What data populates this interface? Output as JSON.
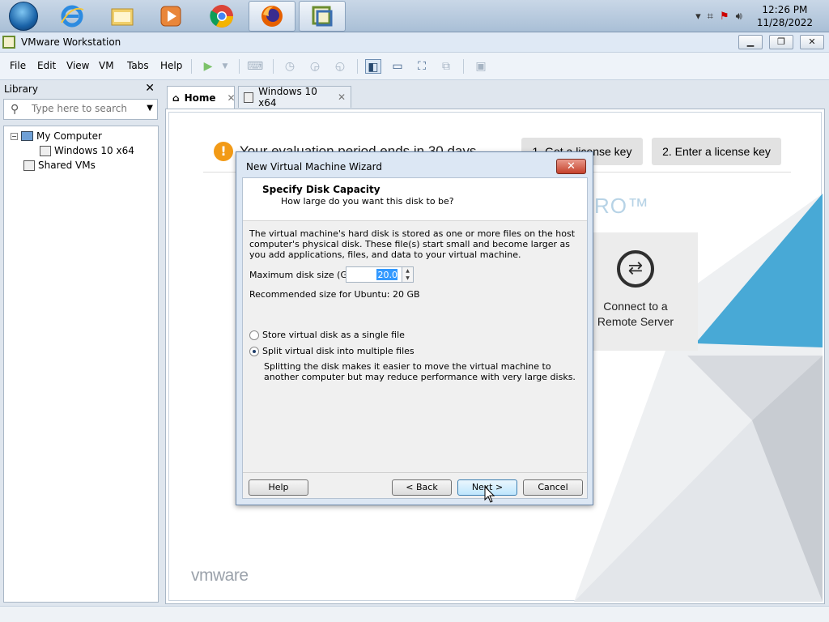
{
  "taskbar": {
    "apps": [
      "start-orb",
      "ie-icon",
      "explorer-icon",
      "media-player-icon",
      "chrome-icon",
      "firefox-icon",
      "vmware-icon"
    ],
    "clock": {
      "time": "12:26 PM",
      "date": "11/28/2022"
    }
  },
  "window": {
    "title": "VMware Workstation",
    "controls": [
      "minimize",
      "restore",
      "close"
    ]
  },
  "menubar": {
    "items": [
      "File",
      "Edit",
      "View",
      "VM",
      "Tabs",
      "Help"
    ]
  },
  "library": {
    "title": "Library",
    "search_placeholder": "Type here to search",
    "tree": {
      "my_computer": "My Computer",
      "vm": "Windows 10 x64",
      "shared": "Shared VMs"
    }
  },
  "tabs": [
    {
      "label": "Home",
      "active": true
    },
    {
      "label": "Windows 10 x64",
      "active": false
    }
  ],
  "home": {
    "eval_text": "Your evaluation period ends in 30 days",
    "btn_get_key": "1. Get a license key",
    "btn_enter_key": "2. Enter a license key",
    "pro_text": "RO™",
    "tile_text_1": "Connect to a",
    "tile_text_2": "Remote Server",
    "brand": "vmware"
  },
  "dialog": {
    "title": "New Virtual Machine Wizard",
    "heading": "Specify Disk Capacity",
    "subheading": "How large do you want this disk to be?",
    "description": "The virtual machine's hard disk is stored as one or more files on the host computer's physical disk. These file(s) start small and become larger as you add applications, files, and data to your virtual machine.",
    "max_size_label": "Maximum disk size (GB):",
    "max_size_value": "20.0",
    "recommended": "Recommended size for Ubuntu: 20 GB",
    "option_single": "Store virtual disk as a single file",
    "option_split": "Split virtual disk into multiple files",
    "selected_option": "split",
    "split_description": "Splitting the disk makes it easier to move the virtual machine to another computer but may reduce performance with very large disks.",
    "buttons": {
      "help": "Help",
      "back": "< Back",
      "next": "Next >",
      "cancel": "Cancel"
    }
  },
  "colors": {
    "accent": "#3399ff",
    "warning": "#f29a16",
    "close_red": "#c5412b"
  }
}
